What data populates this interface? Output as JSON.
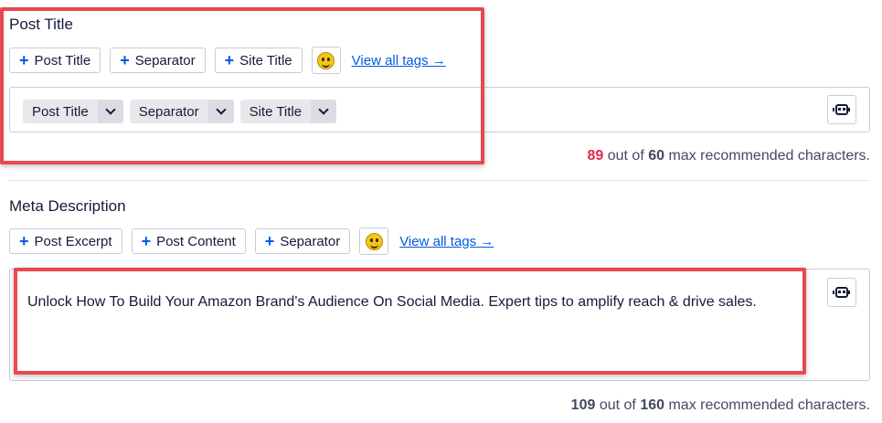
{
  "post_title": {
    "label": "Post Title",
    "tag_buttons": [
      {
        "label": "Post Title"
      },
      {
        "label": "Separator"
      },
      {
        "label": "Site Title"
      }
    ],
    "emoji_icon": "smiley-icon",
    "view_all_tags": "View all tags →",
    "pills": [
      {
        "label": "Post Title"
      },
      {
        "label": "Separator"
      },
      {
        "label": "Site Title"
      }
    ],
    "counter": {
      "current": "89",
      "max": "60",
      "out_of": "out of",
      "suffix": "max recommended characters."
    }
  },
  "meta_description": {
    "label": "Meta Description",
    "tag_buttons": [
      {
        "label": "Post Excerpt"
      },
      {
        "label": "Post Content"
      },
      {
        "label": "Separator"
      }
    ],
    "emoji_icon": "smiley-icon",
    "view_all_tags": "View all tags →",
    "text": "Unlock How To Build Your Amazon Brand's Audience On Social Media. Expert tips to amplify reach & drive sales.",
    "counter": {
      "current": "109",
      "max": "160",
      "out_of": "out of",
      "suffix": "max recommended characters."
    }
  },
  "colors": {
    "accent": "#005ae0",
    "over_limit": "#df2a4a",
    "highlight": "#e8484f"
  }
}
